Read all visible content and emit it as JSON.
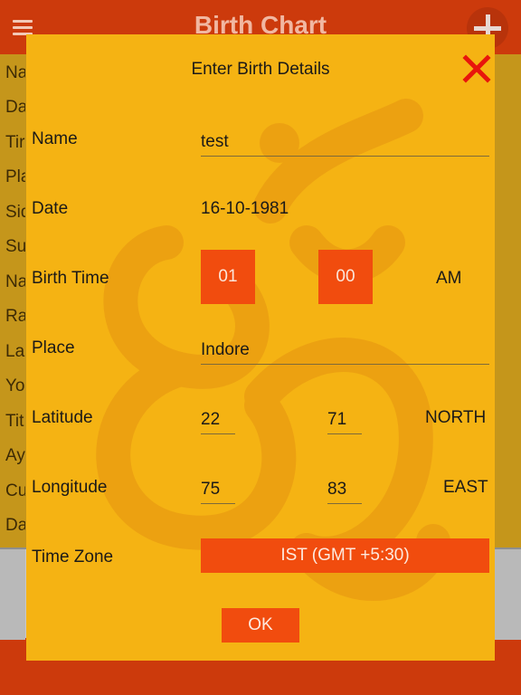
{
  "app": {
    "title": "Birth Chart"
  },
  "background_rows": [
    "Na",
    "Da",
    "Tir",
    "Pla",
    "Sid",
    "Su",
    "Na",
    "Ra",
    "La",
    "Yo",
    "Tit",
    "Ay",
    "Cu",
    "Da"
  ],
  "dialog": {
    "title": "Enter Birth Details",
    "close_icon": "close-icon",
    "name": {
      "label": "Name",
      "value": "test"
    },
    "date": {
      "label": "Date",
      "value": "16-10-1981"
    },
    "birth_time": {
      "label": "Birth Time",
      "hour": "01",
      "minute": "00",
      "ampm": "AM"
    },
    "place": {
      "label": "Place",
      "value": "Indore"
    },
    "latitude": {
      "label": "Latitude",
      "degrees": "22",
      "minutes": "71",
      "direction": "NORTH"
    },
    "longitude": {
      "label": "Longitude",
      "degrees": "75",
      "minutes": "83",
      "direction": "EAST"
    },
    "time_zone": {
      "label": "Time Zone",
      "value": "IST (GMT +5:30)"
    },
    "ok_label": "OK"
  },
  "colors": {
    "header": "#cc3a0c",
    "dialog_bg": "#f5b313",
    "button_bg": "#f14c0e",
    "close_x": "#e8150c"
  }
}
